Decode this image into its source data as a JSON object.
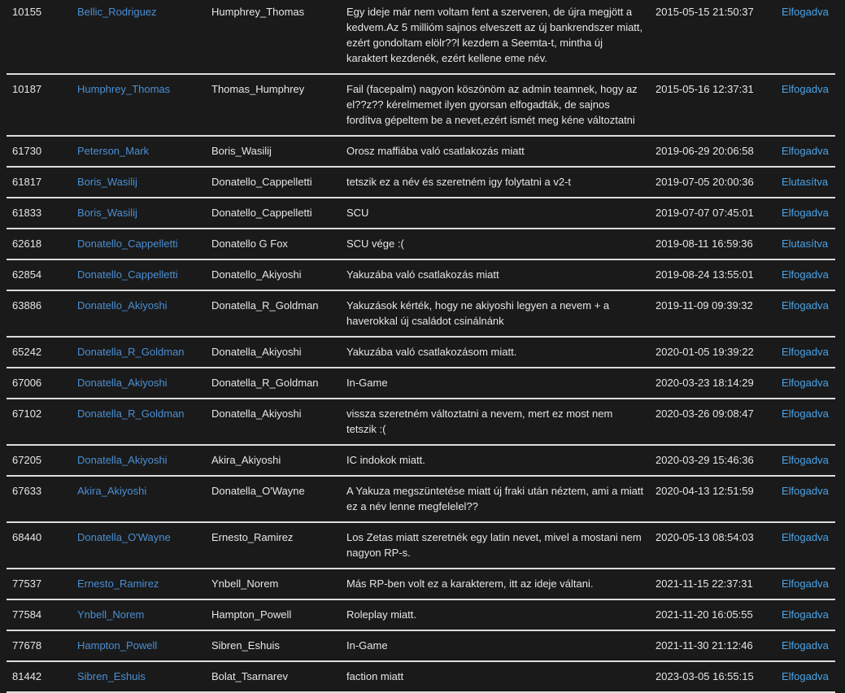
{
  "rows": [
    {
      "id": "10155",
      "old_name": "Bellic_Rodriguez",
      "new_name": "Humphrey_Thomas",
      "reason": "Egy ideje már nem voltam fent a szerveren, de újra megjött a kedvem.Az 5 millióm sajnos elveszett az új bankrendszer miatt, ezért gondoltam elölr??l kezdem a Seemta-t, mintha új karaktert kezdenék, ezért kellene eme név.",
      "date": "2015-05-15 21:50:37",
      "status": "Elfogadva"
    },
    {
      "id": "10187",
      "old_name": "Humphrey_Thomas",
      "new_name": "Thomas_Humphrey",
      "reason": "Fail (facepalm) nagyon köszönöm az admin teamnek, hogy az el??z?? kérelmemet ilyen gyorsan elfogadták, de sajnos fordítva gépeltem be a nevet,ezért ismét meg kéne változtatni",
      "date": "2015-05-16 12:37:31",
      "status": "Elfogadva"
    },
    {
      "id": "61730",
      "old_name": "Peterson_Mark",
      "new_name": "Boris_Wasilij",
      "reason": "Orosz maffiába való csatlakozás miatt",
      "date": "2019-06-29 20:06:58",
      "status": "Elfogadva"
    },
    {
      "id": "61817",
      "old_name": "Boris_Wasilij",
      "new_name": "Donatello_Cappelletti",
      "reason": "tetszik ez a név és szeretném igy folytatni a v2-t",
      "date": "2019-07-05 20:00:36",
      "status": "Elutasítva"
    },
    {
      "id": "61833",
      "old_name": "Boris_Wasilij",
      "new_name": "Donatello_Cappelletti",
      "reason": "SCU",
      "date": "2019-07-07 07:45:01",
      "status": "Elfogadva"
    },
    {
      "id": "62618",
      "old_name": "Donatello_Cappelletti",
      "new_name": "Donatello G Fox",
      "reason": "SCU vége :(",
      "date": "2019-08-11 16:59:36",
      "status": "Elutasítva"
    },
    {
      "id": "62854",
      "old_name": "Donatello_Cappelletti",
      "new_name": "Donatello_Akiyoshi",
      "reason": "Yakuzába való csatlakozás miatt",
      "date": "2019-08-24 13:55:01",
      "status": "Elfogadva"
    },
    {
      "id": "63886",
      "old_name": "Donatello_Akiyoshi",
      "new_name": "Donatella_R_Goldman",
      "reason": "Yakuzások kérték, hogy ne akiyoshi legyen a nevem + a haverokkal új családot csinálnánk",
      "date": "2019-11-09 09:39:32",
      "status": "Elfogadva"
    },
    {
      "id": "65242",
      "old_name": "Donatella_R_Goldman",
      "new_name": "Donatella_Akiyoshi",
      "reason": "Yakuzába való csatlakozásom miatt.",
      "date": "2020-01-05 19:39:22",
      "status": "Elfogadva"
    },
    {
      "id": "67006",
      "old_name": "Donatella_Akiyoshi",
      "new_name": "Donatella_R_Goldman",
      "reason": "In-Game",
      "date": "2020-03-23 18:14:29",
      "status": "Elfogadva"
    },
    {
      "id": "67102",
      "old_name": "Donatella_R_Goldman",
      "new_name": "Donatella_Akiyoshi",
      "reason": "vissza szeretném változtatni a nevem, mert ez most nem tetszik :(",
      "date": "2020-03-26 09:08:47",
      "status": "Elfogadva"
    },
    {
      "id": "67205",
      "old_name": "Donatella_Akiyoshi",
      "new_name": "Akira_Akiyoshi",
      "reason": "IC indokok miatt.",
      "date": "2020-03-29 15:46:36",
      "status": "Elfogadva"
    },
    {
      "id": "67633",
      "old_name": "Akira_Akiyoshi",
      "new_name": "Donatella_O'Wayne",
      "reason": "A Yakuza megszüntetése miatt új fraki után néztem, ami a miatt ez a név lenne megfelelel??",
      "date": "2020-04-13 12:51:59",
      "status": "Elfogadva"
    },
    {
      "id": "68440",
      "old_name": "Donatella_O'Wayne",
      "new_name": "Ernesto_Ramirez",
      "reason": "Los Zetas miatt szeretnék egy latin nevet, mivel a mostani nem nagyon RP-s.",
      "date": "2020-05-13 08:54:03",
      "status": "Elfogadva"
    },
    {
      "id": "77537",
      "old_name": "Ernesto_Ramirez",
      "new_name": "Ynbell_Norem",
      "reason": "Más RP-ben volt ez a karakterem, itt az ideje váltani.",
      "date": "2021-11-15 22:37:31",
      "status": "Elfogadva"
    },
    {
      "id": "77584",
      "old_name": "Ynbell_Norem",
      "new_name": "Hampton_Powell",
      "reason": "Roleplay miatt.",
      "date": "2021-11-20 16:05:55",
      "status": "Elfogadva"
    },
    {
      "id": "77678",
      "old_name": "Hampton_Powell",
      "new_name": "Sibren_Eshuis",
      "reason": "In-Game",
      "date": "2021-11-30 21:12:46",
      "status": "Elfogadva"
    },
    {
      "id": "81442",
      "old_name": "Sibren_Eshuis",
      "new_name": "Bolat_Tsarnarev",
      "reason": "faction miatt",
      "date": "2023-03-05 16:55:15",
      "status": "Elfogadva"
    }
  ],
  "colors": {
    "background": "#1a1a1a",
    "text": "#e6e6e6",
    "link": "#4a8fd4",
    "status": "#4aa3e8",
    "separator": "#dcdcdc"
  }
}
